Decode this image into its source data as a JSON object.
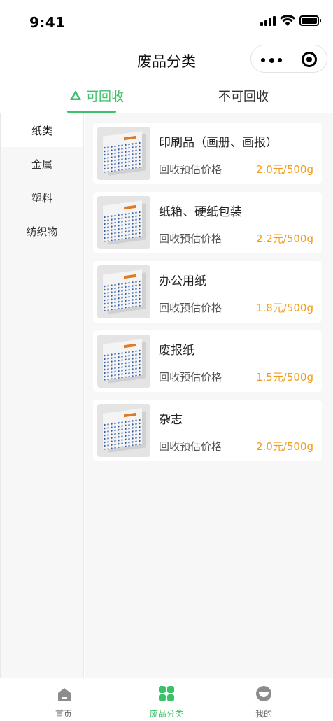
{
  "status_bar": {
    "time": "9:41"
  },
  "nav": {
    "title": "废品分类"
  },
  "tabs": [
    {
      "label": "可回收",
      "active": true,
      "icon": "recycle-icon"
    },
    {
      "label": "不可回收",
      "active": false
    }
  ],
  "sidebar": {
    "items": [
      {
        "label": "纸类",
        "active": true
      },
      {
        "label": "金属",
        "active": false
      },
      {
        "label": "塑料",
        "active": false
      },
      {
        "label": "纺织物",
        "active": false
      }
    ]
  },
  "items": [
    {
      "name": "印刷品（画册、画报）",
      "price_label": "回收预估价格",
      "price": "2.0元/500g"
    },
    {
      "name": "纸箱、硬纸包装",
      "price_label": "回收预估价格",
      "price": "2.2元/500g"
    },
    {
      "name": "办公用纸",
      "price_label": "回收预估价格",
      "price": "1.8元/500g"
    },
    {
      "name": "废报纸",
      "price_label": "回收预估价格",
      "price": "1.5元/500g"
    },
    {
      "name": "杂志",
      "price_label": "回收预估价格",
      "price": "2.0元/500g"
    }
  ],
  "tabbar": [
    {
      "label": "首页",
      "icon": "home-icon",
      "active": false
    },
    {
      "label": "废品分类",
      "icon": "grid-icon",
      "active": true
    },
    {
      "label": "我的",
      "icon": "profile-icon",
      "active": false
    }
  ],
  "colors": {
    "accent": "#3cc06a",
    "price": "#f39b18",
    "background": "#f7f7f7"
  }
}
